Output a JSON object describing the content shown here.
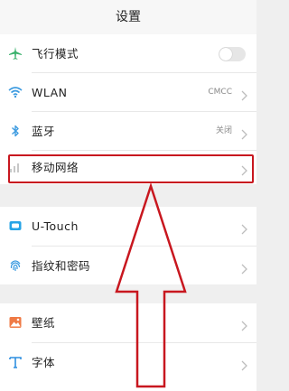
{
  "header": {
    "title": "设置"
  },
  "rows": {
    "airplane": {
      "label": "飞行模式",
      "icon": "airplane-icon",
      "toggle_on": false
    },
    "wlan": {
      "label": "WLAN",
      "value": "CMCC",
      "icon": "wifi-icon"
    },
    "bluetooth": {
      "label": "蓝牙",
      "value": "关闭",
      "icon": "bluetooth-icon"
    },
    "mobile": {
      "label": "移动网络",
      "icon": "signal-bars-icon"
    },
    "utouch": {
      "label": "U-Touch",
      "icon": "utouch-icon"
    },
    "fingerprint": {
      "label": "指纹和密码",
      "icon": "fingerprint-icon"
    },
    "wallpaper": {
      "label": "壁纸",
      "icon": "wallpaper-icon"
    },
    "font": {
      "label": "字体",
      "icon": "font-icon"
    }
  },
  "colors": {
    "accent_green": "#3ab26d",
    "wifi_blue": "#3d9be0",
    "highlight_red": "#c8171f",
    "utouch_blue": "#27a4e6",
    "wallpaper_orange": "#ef7a45",
    "font_blue": "#2f8fe0"
  },
  "annotation": {
    "shape": "upward-arrow",
    "highlights": "mobile"
  }
}
